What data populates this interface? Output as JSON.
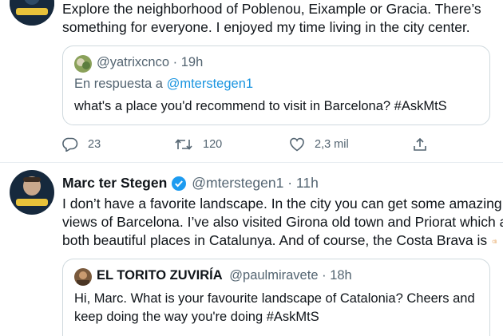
{
  "tweet1": {
    "line1": "Explore the neighborhood of Poblenou, Eixample or Gracia. There’s",
    "line2": "something for everyone. I enjoyed my time living in the city center.",
    "quote": {
      "handle": "@yatrixcnco",
      "time": "19h",
      "reply_prefix": "En respuesta a ",
      "reply_handle": "@mterstegen1",
      "text": "what's a place you'd recommend to visit in Barcelona? #AskMtS"
    },
    "actions": {
      "replies": "23",
      "retweets": "120",
      "likes": "2,3 mil"
    }
  },
  "tweet2": {
    "author_name": "Marc ter Stegen",
    "author_handle": "@mterstegen1",
    "time": "11h",
    "line1": "I don’t have a favorite landscape. In the city you can get some amazing",
    "line2": "views of Barcelona. I’ve also visited Girona old town and Priorat which are",
    "line3": "both beautiful places in Catalunya. And of course, the Costa Brava is",
    "quote": {
      "author_name": "EL TORITO ZUVIRÍA",
      "handle": "@paulmiravete",
      "time": "18h",
      "line1": "Hi, Marc. What is your favourite landscape of Catalonia? Cheers and",
      "line2": "keep doing the way you're doing #AskMtS"
    }
  },
  "colors": {
    "link": "#1b95e0",
    "muted": "#536471",
    "border": "#cfd9de",
    "verified": "#1d9bf0"
  }
}
